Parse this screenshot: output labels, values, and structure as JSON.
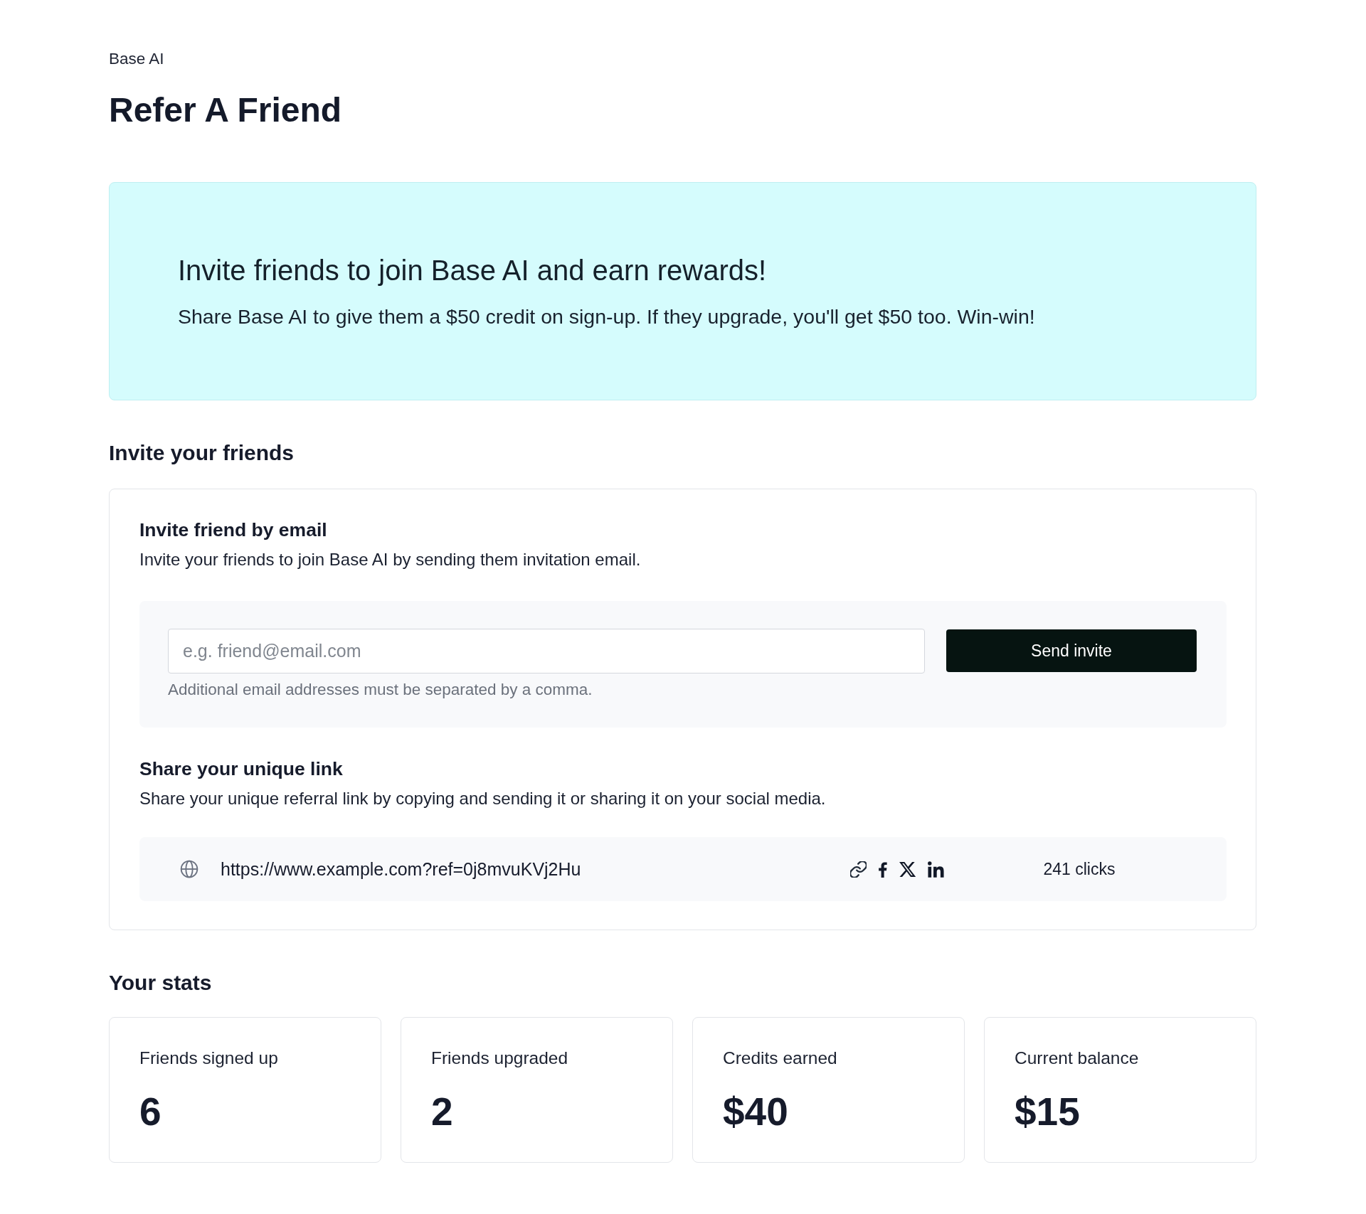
{
  "header": {
    "breadcrumb": "Base AI",
    "title": "Refer A Friend"
  },
  "banner": {
    "title": "Invite friends to join Base AI and earn rewards!",
    "text": "Share Base AI to give them a $50 credit on sign-up. If they upgrade, you'll get $50 too. Win-win!"
  },
  "invite_section": {
    "heading": "Invite your friends",
    "email": {
      "title": "Invite friend by email",
      "description": "Invite your friends to join Base AI by sending them invitation email.",
      "field": {
        "placeholder": "e.g. friend@email.com"
      },
      "button": "Send invite",
      "hint": "Additional email addresses must be separated by a comma."
    },
    "link": {
      "title": "Share your unique link",
      "description": "Share your unique referral link by copying and sending it or sharing it on your social media.",
      "url": "https://www.example.com?ref=0j8mvuKVj2Hu",
      "clicks": "241 clicks"
    }
  },
  "stats": {
    "heading": "Your stats",
    "cards": [
      {
        "label": "Friends signed up",
        "value": "6"
      },
      {
        "label": "Friends upgraded",
        "value": "2"
      },
      {
        "label": "Credits earned",
        "value": "$40"
      },
      {
        "label": "Current balance",
        "value": "$15"
      }
    ]
  }
}
